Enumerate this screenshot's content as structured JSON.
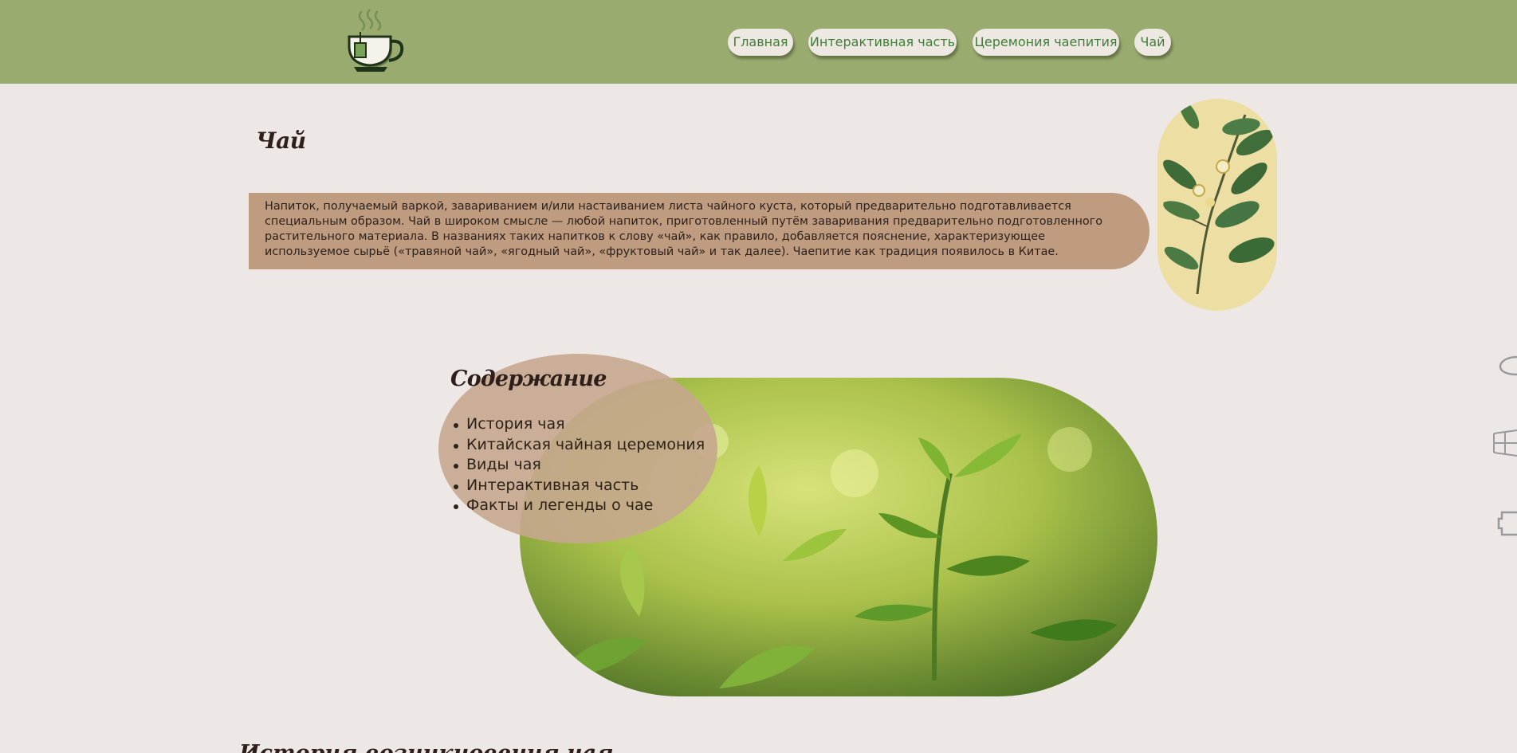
{
  "header": {
    "logo_icon": "tea-cup-logo-icon",
    "nav": [
      {
        "label": "Главная"
      },
      {
        "label": "Интерактивная часть"
      },
      {
        "label": "Церемония чаепития"
      },
      {
        "label": "Чай"
      }
    ]
  },
  "intro": {
    "title": "Чай",
    "text": "Напиток, получаемый варкой, завариванием и/или настаиванием листа чайного куста, который предварительно подготавливается специальным образом. Чай в широком смысле — любой напиток, приготовленный путём заваривания предварительно подготовленного растительного материала. В названиях таких напитков к слову «чай», как правило, добавляется пояснение, характеризующее используемое сырьё («травяной чай», «ягодный чай», «фруктовый чай» и так далее). Чаепитие как традиция появилось в Китае."
  },
  "contents": {
    "title": "Содержание",
    "items": [
      "История чая",
      "Китайская чайная церемония",
      "Виды чая",
      "Интерактивная часть",
      "Факты и легенды о чае"
    ]
  },
  "history": {
    "title": "История возникновения чая"
  },
  "colors": {
    "header_bg": "#9aab70",
    "page_bg": "#ede8e5",
    "nav_text": "#3f7d36",
    "intro_bg": "#bf9c80",
    "toc_bg": "#c5a78e"
  },
  "side_icons": [
    "brush-icon",
    "windows-icon",
    "puzzle-icon"
  ]
}
